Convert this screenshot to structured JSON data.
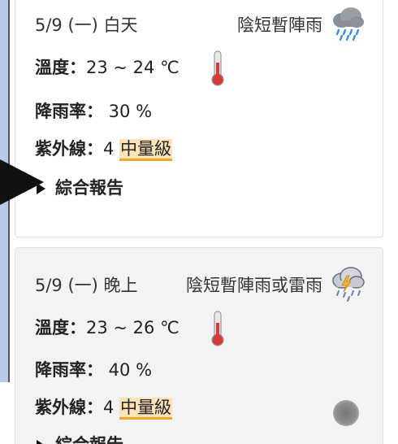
{
  "forecasts": [
    {
      "date": "5/9 (一) 白天",
      "weather": "陰短暫陣雨",
      "weather_icon": "rain-cloud-icon",
      "temp_label": "溫度：",
      "temp_value": "23 ~ 24 ℃",
      "rain_label": "降雨率：",
      "rain_value": " 30 %",
      "uv_label": "紫外線：",
      "uv_value": "4 ",
      "uv_level": "中量級",
      "report_label": "綜合報告"
    },
    {
      "date": "5/9 (一) 晚上",
      "weather": "陰短暫陣雨或雷雨",
      "weather_icon": "thunderstorm-cloud-icon",
      "temp_label": "溫度：",
      "temp_value": "23 ~ 26 ℃",
      "rain_label": "降雨率：",
      "rain_value": " 40 %",
      "uv_label": "紫外線：",
      "uv_value": "4 ",
      "uv_level": "中量級",
      "report_label": "綜合報告"
    }
  ],
  "colors": {
    "uv_badge_bg": "#fbe3b8",
    "uv_badge_underline": "#f0a52b",
    "night_card_bg": "#f3f3f3",
    "left_strip": "#b7c8ea"
  }
}
